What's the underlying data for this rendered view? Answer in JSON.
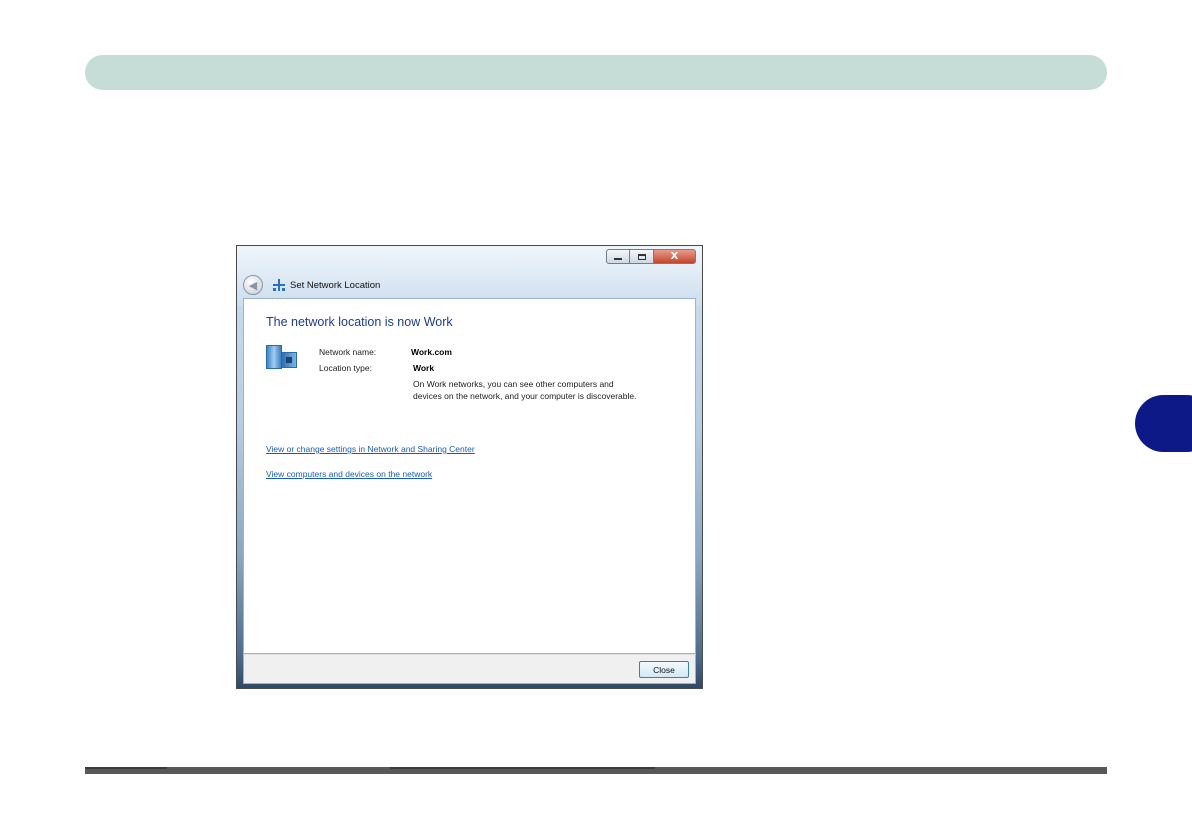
{
  "window": {
    "wizard_title": "Set Network Location",
    "controls": {
      "minimize": "minimize",
      "maximize": "maximize",
      "close": "X"
    }
  },
  "content": {
    "heading": "The network location is now Work",
    "network_name_label": "Network name:",
    "network_name_value": "Work.com",
    "location_type_label": "Location type:",
    "location_type_value": "Work",
    "description": "On Work networks, you can see other computers and devices on the network, and your computer is discoverable.",
    "links": [
      "View or change settings in Network and Sharing Center",
      "View computers and devices on the network"
    ]
  },
  "footer": {
    "close_label": "Close"
  },
  "colors": {
    "header_bar": "#c5dcd7",
    "chapter_tab": "#0c1986",
    "footer_rule": "#585858",
    "heading_text": "#1b3d8f",
    "link_text": "#1a5bb5"
  },
  "icons": {
    "back": "back-arrow-icon",
    "network": "network-icon",
    "building": "work-network-building-icon"
  }
}
